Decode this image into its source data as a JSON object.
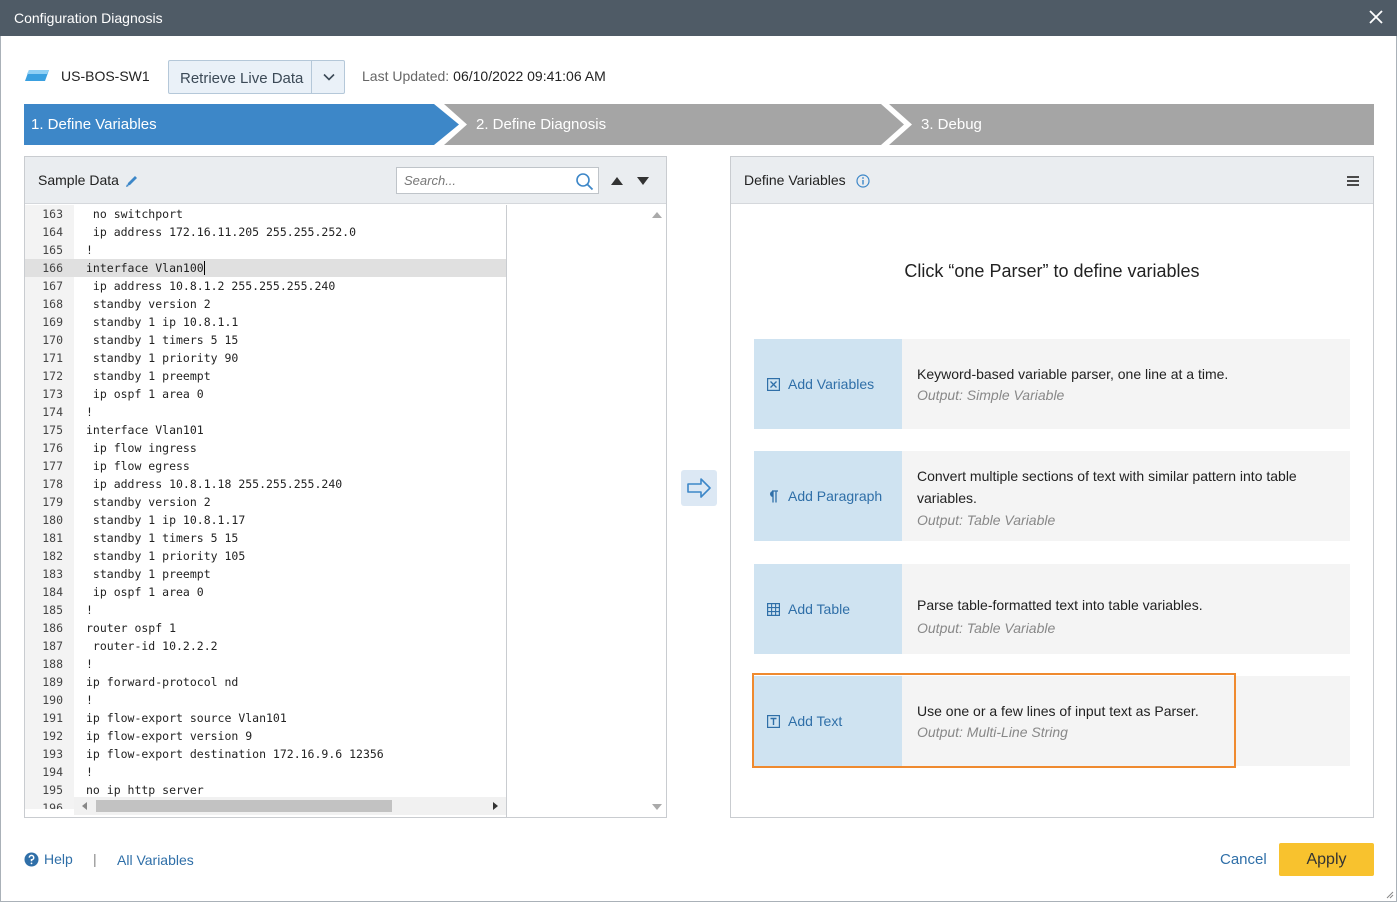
{
  "window": {
    "title": "Configuration Diagnosis"
  },
  "device": {
    "name": "US-BOS-SW1"
  },
  "retrieve": {
    "label": "Retrieve Live Data"
  },
  "last_updated": {
    "label": "Last Updated:",
    "value": "06/10/2022 09:41:06 AM"
  },
  "steps": [
    {
      "label": "1. Define Variables",
      "state": "active"
    },
    {
      "label": "2. Define Diagnosis",
      "state": "inactive"
    },
    {
      "label": "3. Debug",
      "state": "inactive"
    }
  ],
  "sample_data": {
    "title": "Sample Data",
    "search_placeholder": "Search...",
    "lines": [
      {
        "n": "163",
        "t": " no switchport"
      },
      {
        "n": "164",
        "t": " ip address 172.16.11.205 255.255.252.0"
      },
      {
        "n": "165",
        "t": "!"
      },
      {
        "n": "166",
        "t": "interface Vlan100"
      },
      {
        "n": "167",
        "t": " ip address 10.8.1.2 255.255.255.240"
      },
      {
        "n": "168",
        "t": " standby version 2"
      },
      {
        "n": "169",
        "t": " standby 1 ip 10.8.1.1"
      },
      {
        "n": "170",
        "t": " standby 1 timers 5 15"
      },
      {
        "n": "171",
        "t": " standby 1 priority 90"
      },
      {
        "n": "172",
        "t": " standby 1 preempt"
      },
      {
        "n": "173",
        "t": " ip ospf 1 area 0"
      },
      {
        "n": "174",
        "t": "!"
      },
      {
        "n": "175",
        "t": "interface Vlan101"
      },
      {
        "n": "176",
        "t": " ip flow ingress"
      },
      {
        "n": "177",
        "t": " ip flow egress"
      },
      {
        "n": "178",
        "t": " ip address 10.8.1.18 255.255.255.240"
      },
      {
        "n": "179",
        "t": " standby version 2"
      },
      {
        "n": "180",
        "t": " standby 1 ip 10.8.1.17"
      },
      {
        "n": "181",
        "t": " standby 1 timers 5 15"
      },
      {
        "n": "182",
        "t": " standby 1 priority 105"
      },
      {
        "n": "183",
        "t": " standby 1 preempt"
      },
      {
        "n": "184",
        "t": " ip ospf 1 area 0"
      },
      {
        "n": "185",
        "t": "!"
      },
      {
        "n": "186",
        "t": "router ospf 1"
      },
      {
        "n": "187",
        "t": " router-id 10.2.2.2"
      },
      {
        "n": "188",
        "t": "!"
      },
      {
        "n": "189",
        "t": "ip forward-protocol nd"
      },
      {
        "n": "190",
        "t": "!"
      },
      {
        "n": "191",
        "t": "ip flow-export source Vlan101"
      },
      {
        "n": "192",
        "t": "ip flow-export version 9"
      },
      {
        "n": "193",
        "t": "ip flow-export destination 172.16.9.6 12356"
      },
      {
        "n": "194",
        "t": "!"
      },
      {
        "n": "195",
        "t": "no ip http server"
      },
      {
        "n": "196",
        "t": ""
      }
    ],
    "highlighted_line": "166"
  },
  "define_variables": {
    "title": "Define Variables",
    "hint": "Click “one Parser” to define variables",
    "parsers": [
      {
        "button": "Add Variables",
        "icon": "variable-x-icon",
        "desc": "Keyword-based variable parser, one line at a time.",
        "output": "Output: Simple Variable"
      },
      {
        "button": "Add Paragraph",
        "icon": "pilcrow-icon",
        "desc": "Convert multiple sections of text with similar pattern into table variables.",
        "output": "Output: Table Variable"
      },
      {
        "button": "Add Table",
        "icon": "table-grid-icon",
        "desc": "Parse table-formatted text into table variables.",
        "output": "Output: Table Variable"
      },
      {
        "button": "Add Text",
        "icon": "text-t-icon",
        "desc": "Use one or a few lines of input text as Parser.",
        "output": "Output: Multi-Line String"
      }
    ]
  },
  "footer": {
    "help": "Help",
    "separator": "|",
    "all_variables": "All Variables",
    "cancel": "Cancel",
    "apply": "Apply"
  },
  "colors": {
    "titlebar": "#4f5b66",
    "step_active": "#3d87c8",
    "step_inactive": "#a5a5a5",
    "parser_button": "#cfe3f1",
    "highlight_border": "#ef8a2f",
    "apply_button": "#f8c22e",
    "link": "#2f6fa8"
  }
}
